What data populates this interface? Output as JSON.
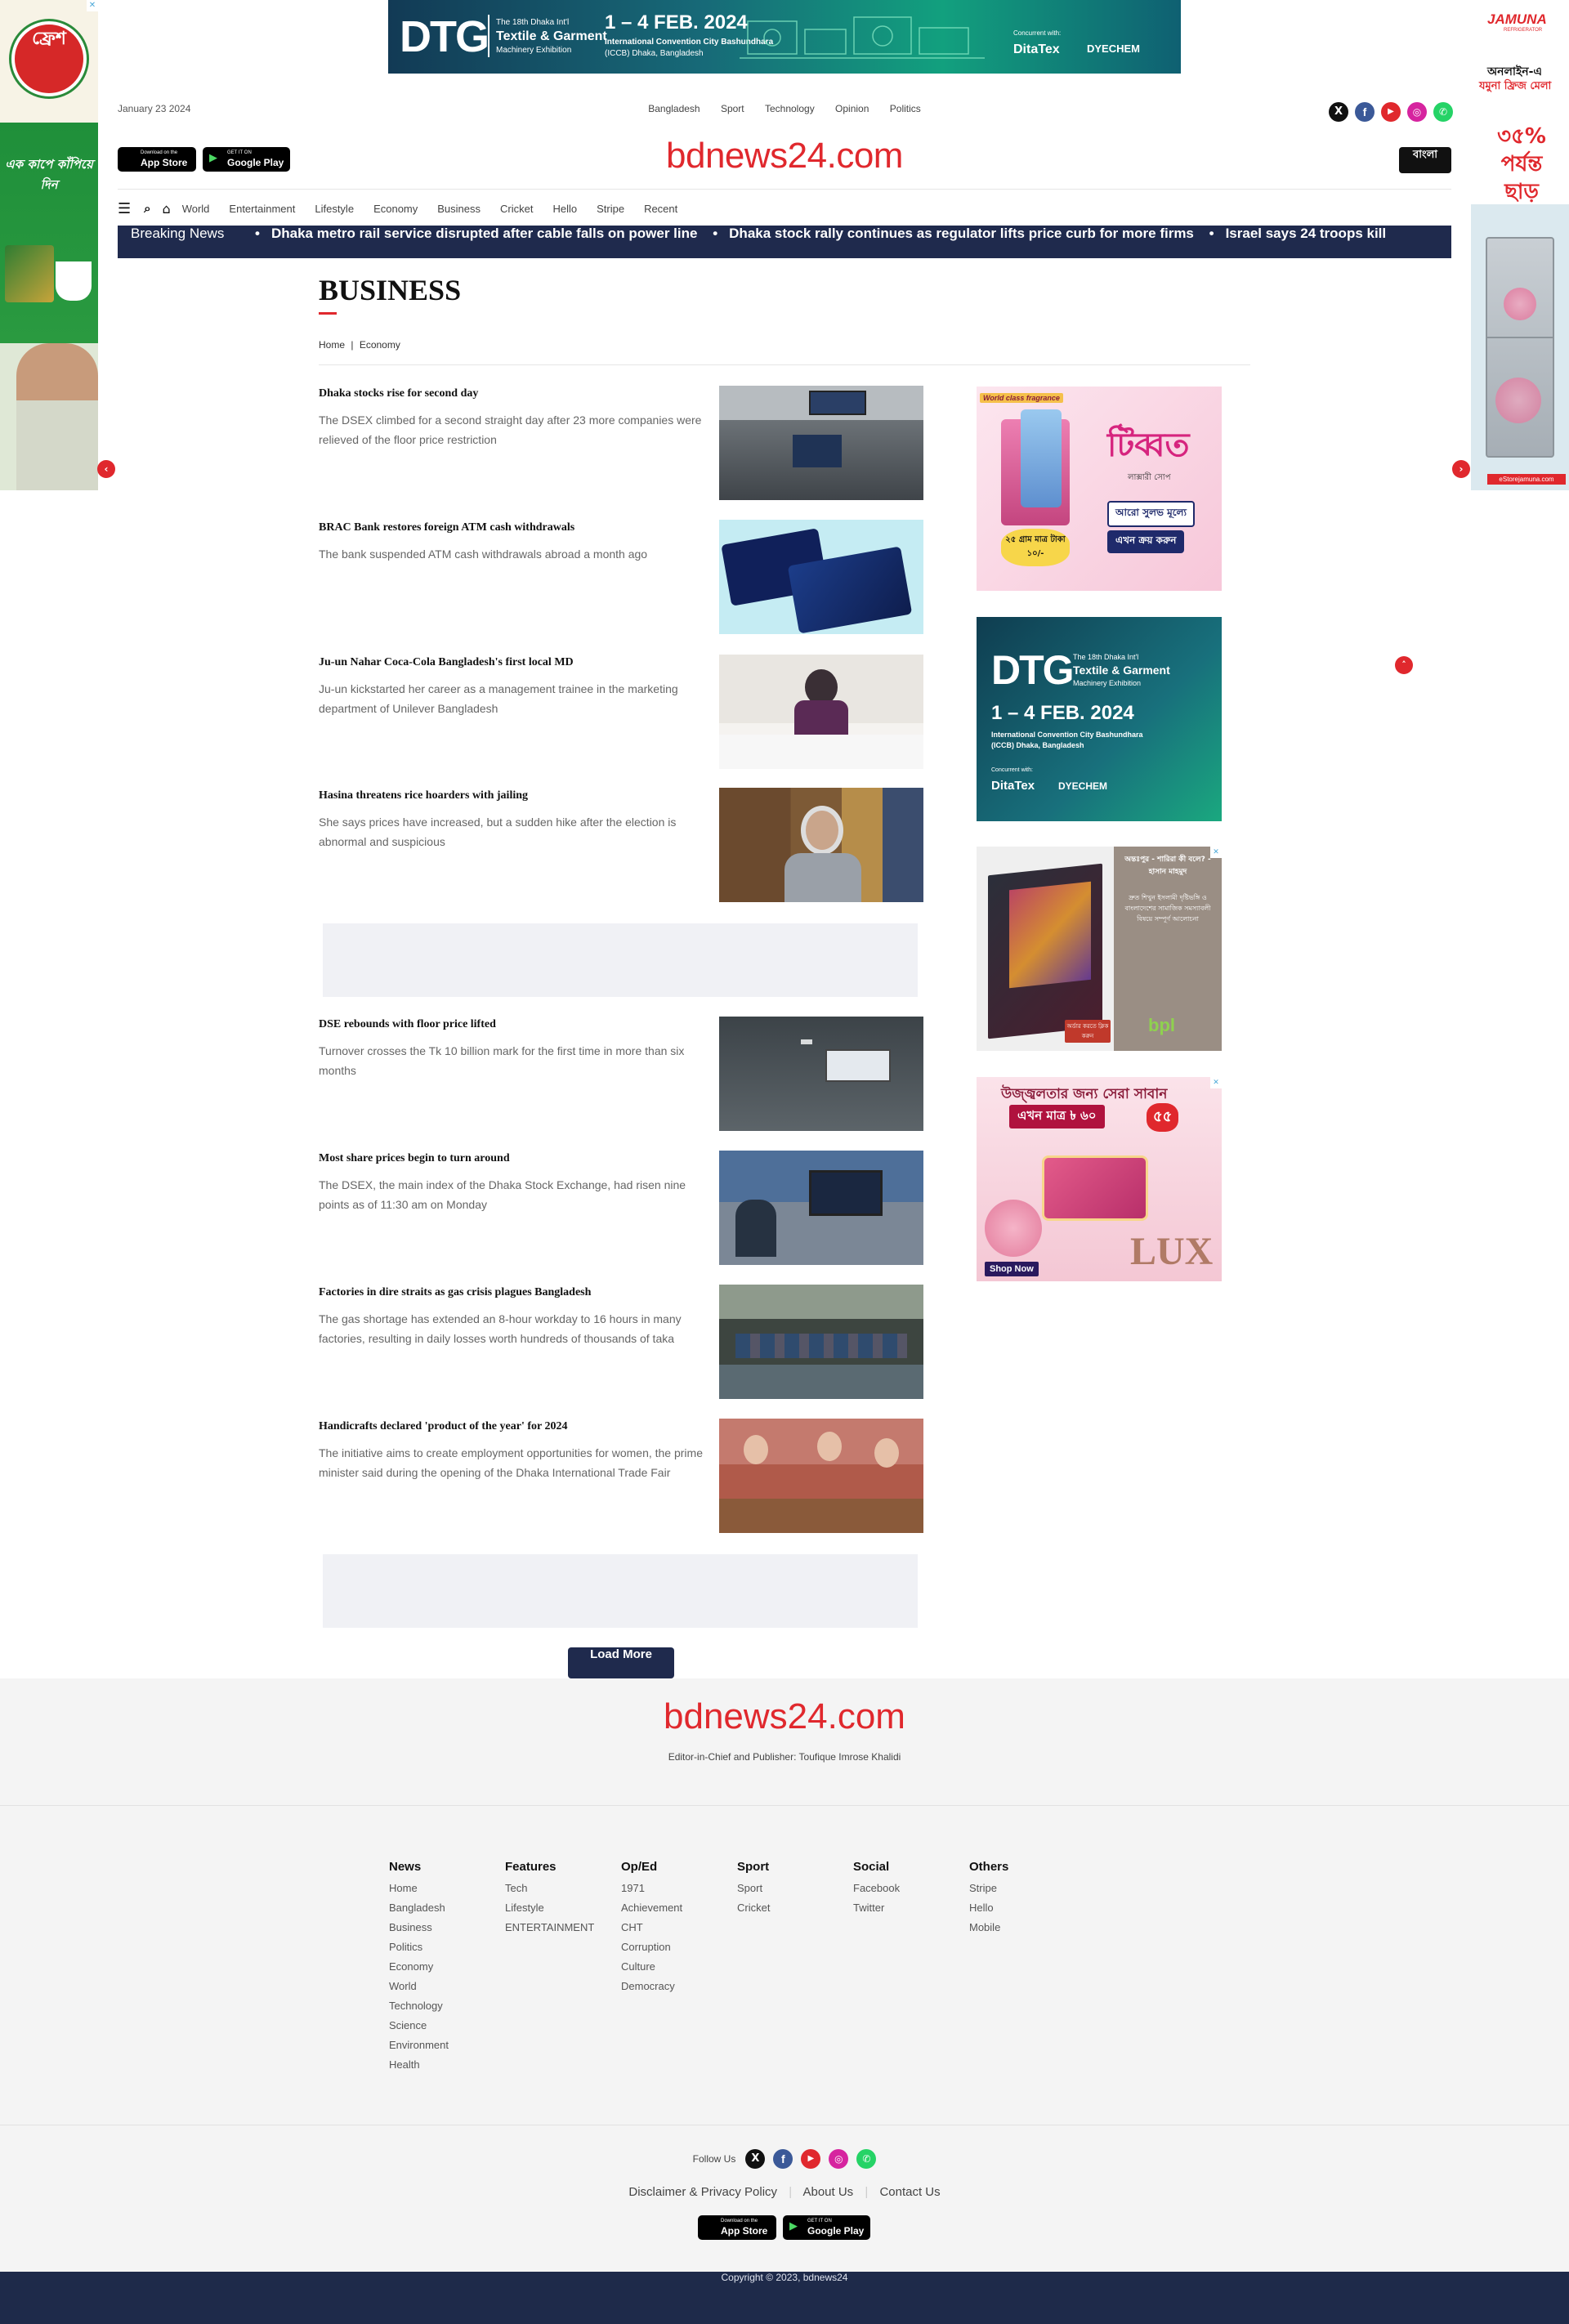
{
  "top_banner": {
    "brand": "DTG",
    "edition": "The 18th Dhaka Int'l",
    "title": "Textile & Garment",
    "subtitle": "Machinery Exhibition",
    "dates": "1 – 4 FEB. 2024",
    "venue": "International Convention City Bashundhara",
    "venue2": "(ICCB) Dhaka, Bangladesh",
    "concurrent": "Concurrent with:",
    "sponsor1": "DitaTex",
    "sponsor2": "DYECHEM"
  },
  "left_ad": {
    "logo": "ফ্রেশ",
    "tagline": "এক কাপে কাঁপিয়ে দিন"
  },
  "right_ad": {
    "brand": "JAMUNA",
    "brand_sub": "REFRIGERATOR",
    "line1": "অনলাইন-এ",
    "line2": "যমুনা ফ্রিজ মেলা",
    "discount": "৩৫% পর্যন্ত ছাড়",
    "site": "eStorejamuna.com"
  },
  "header": {
    "date": "January 23 2024",
    "top_links": [
      "Bangladesh",
      "Sport",
      "Technology",
      "Opinion",
      "Politics"
    ],
    "app_store": {
      "small": "Download on the",
      "big": "App Store"
    },
    "google_play": {
      "small": "GET IT ON",
      "big": "Google Play"
    },
    "logo": "bdnews24.com",
    "lang_button": "বাংলা"
  },
  "nav": {
    "items": [
      "World",
      "Entertainment",
      "Lifestyle",
      "Economy",
      "Business",
      "Cricket",
      "Hello",
      "Stripe",
      "Recent"
    ]
  },
  "breaking": {
    "label": "Breaking News",
    "items": [
      "Dhaka metro rail service disrupted after cable falls on power line",
      "Dhaka stock rally continues as regulator lifts price curb for more firms",
      "Israel says 24 troops kill"
    ]
  },
  "section": {
    "title": "BUSINESS",
    "breadcrumb_home": "Home",
    "breadcrumb_sep": "|",
    "breadcrumb_current": "Economy"
  },
  "articles": [
    {
      "title": "Dhaka stocks rise for second day",
      "summary": "The DSEX climbed for a second straight day after 23 more companies were relieved of the floor price restriction",
      "image": "trading-floor-photo"
    },
    {
      "title": "BRAC Bank restores foreign ATM cash withdrawals",
      "summary": "The bank suspended ATM cash withdrawals abroad a month ago",
      "image": "bank-cards-photo"
    },
    {
      "title": "Ju-un Nahar Coca-Cola Bangladesh's first local MD",
      "summary": "Ju-un kickstarted her career as a management trainee in the marketing department of Unilever Bangladesh",
      "image": "executive-portrait-photo"
    },
    {
      "title": "Hasina threatens rice hoarders with jailing",
      "summary": "She says prices have increased, but a sudden hike after the election is abnormal and suspicious",
      "image": "prime-minister-photo"
    },
    {
      "title": "DSE rebounds with floor price lifted",
      "summary": "Turnover crosses the Tk 10 billion mark for the first time in more than six months",
      "image": "stock-board-photo"
    },
    {
      "title": "Most share prices begin to turn around",
      "summary": "The DSEX, the main index of the Dhaka Stock Exchange, had risen nine points as of 11:30 am on Monday",
      "image": "investor-monitor-photo"
    },
    {
      "title": "Factories in dire straits as gas crisis plagues Bangladesh",
      "summary": "The gas shortage has extended an 8-hour workday to 16 hours in many factories, resulting in daily losses worth hundreds of thousands of taka",
      "image": "factory-floor-photo"
    },
    {
      "title": "Handicrafts declared 'product of the year' for 2024",
      "summary": "The initiative aims to create employment opportunities for women, the prime minister said during the opening of the Dhaka International Trade Fair",
      "image": "trade-fair-photo"
    }
  ],
  "load_more": "Load More",
  "sidebar_ads": {
    "ad1": {
      "tag": "World class fragrance",
      "brand": "টিব্বত",
      "line1": "লাক্সারী সোপ",
      "price": "২৫ গ্রাম মাত্র টাকা ১০/-",
      "cta1": "আরো সুলভ মূল্যে",
      "cta2": "এখন ক্রয় করুন"
    },
    "ad2": {
      "brand": "DTG",
      "edition": "The 18th Dhaka Int'l",
      "title": "Textile & Garment",
      "subtitle": "Machinery Exhibition",
      "dates": "1 – 4 FEB. 2024",
      "venue": "International Convention City Bashundhara (ICCB) Dhaka, Bangladesh",
      "concurrent": "Concurrent with:",
      "sponsor1": "DitaTex",
      "sponsor2": "DYECHEM"
    },
    "ad3": {
      "title": "অন্তঃপুর - শারিরা কী বলে? - হাসান মাহমুদ",
      "body": "দ্রুত শিখুন ইসলামী দৃষ্টিভঙ্গি ও বাংলাদেশের সামাজিক সমস্যাবলী বিষয়ে সম্পূর্ণ আলোচনা",
      "cta": "অর্ডার করতে ক্লিক করুন",
      "publisher": "bpl"
    },
    "ad4": {
      "headline": "উজ্জ্বলতার জন্য সেরা সাবান",
      "price": "এখন মাত্র ৳ ৬০",
      "badge": "৫৫",
      "brand": "LUX",
      "cta": "Shop Now"
    }
  },
  "footer": {
    "logo": "bdnews24.com",
    "editor": "Editor-in-Chief and Publisher: Toufique Imrose Khalidi",
    "columns": [
      {
        "heading": "News",
        "links": [
          "Home",
          "Bangladesh",
          "Business",
          "Politics",
          "Economy",
          "World",
          "Technology",
          "Science",
          "Environment",
          "Health"
        ]
      },
      {
        "heading": "Features",
        "links": [
          "Tech",
          "Lifestyle",
          "ENTERTAINMENT"
        ]
      },
      {
        "heading": "Op/Ed",
        "links": [
          "1971",
          "Achievement",
          "CHT",
          "Corruption",
          "Culture",
          "Democracy"
        ]
      },
      {
        "heading": "Sport",
        "links": [
          "Sport",
          "Cricket"
        ]
      },
      {
        "heading": "Social",
        "links": [
          "Facebook",
          "Twitter"
        ]
      },
      {
        "heading": "Others",
        "links": [
          "Stripe",
          "Hello",
          "Mobile"
        ]
      }
    ],
    "follow_us": "Follow Us",
    "links": [
      "Disclaimer & Privacy Policy",
      "About Us",
      "Contact Us"
    ],
    "copyright": "Copyright © 2023, bdnews24"
  },
  "colors": {
    "brand_red": "#e0282d",
    "navy": "#1f2a4d",
    "footer_bg": "#f4f4f4",
    "copyright_bg": "#1e2a4a"
  }
}
